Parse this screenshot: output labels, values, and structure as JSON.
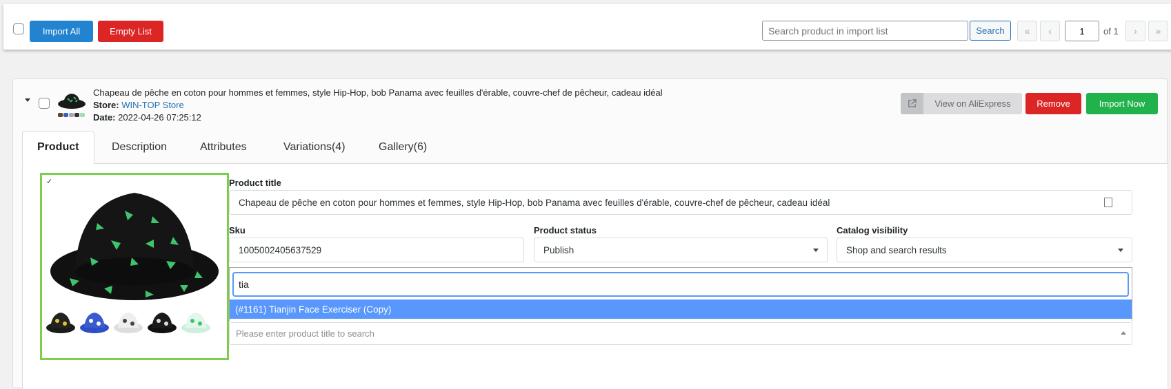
{
  "toolbar": {
    "import_all": "Import All",
    "empty_list": "Empty List",
    "search_placeholder": "Search product in import list",
    "search_button": "Search",
    "page_value": "1",
    "page_of": "of 1",
    "first": "«",
    "prev": "‹",
    "next": "›",
    "last": "»"
  },
  "product": {
    "title": "Chapeau de pêche en coton pour hommes et femmes, style Hip-Hop, bob Panama avec feuilles d'érable, couvre-chef de pêcheur, cadeau idéal",
    "store_label": "Store:",
    "store_name": "WIN-TOP Store",
    "date_label": "Date:",
    "date": "2022-04-26 07:25:12"
  },
  "actions": {
    "view_on": "View on AliExpress",
    "remove": "Remove",
    "import_now": "Import Now"
  },
  "tabs": [
    {
      "label": "Product"
    },
    {
      "label": "Description"
    },
    {
      "label": "Attributes"
    },
    {
      "label": "Variations(4)"
    },
    {
      "label": "Gallery(6)"
    }
  ],
  "form": {
    "title_label": "Product title",
    "title_value": "Chapeau de pêche en coton pour hommes et femmes, style Hip-Hop, bob Panama avec feuilles d'érable, couvre-chef de pêcheur, cadeau idéal",
    "sku_label": "Sku",
    "sku_value": "1005002405637529",
    "status_label": "Product status",
    "status_value": "Publish",
    "visibility_label": "Catalog visibility",
    "visibility_value": "Shop and search results",
    "dropdown_search": "tia",
    "dropdown_option": "(#1161) Tianjin Face Exerciser (Copy)",
    "product_search_placeholder": "Please enter product title to search"
  },
  "image": {
    "checkmark": "✓"
  },
  "colors": {
    "blue": "#2283d0",
    "red": "#dc2626",
    "green": "#22b24c",
    "highlight": "#5897fb",
    "frame": "#7ccf4e"
  }
}
